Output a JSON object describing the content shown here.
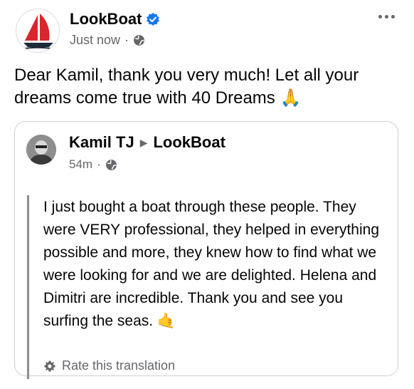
{
  "post": {
    "page_name": "LookBoat",
    "time": "Just now",
    "separator": "·",
    "text": "Dear Kamil, thank you very much! Let all your dreams come true with 40 Dreams 🙏"
  },
  "shared": {
    "author": "Kamil TJ",
    "target": "LookBoat",
    "arrow": "▶",
    "time": "54m",
    "separator": "·",
    "body": "I just bought a boat through these people. They were VERY professional, they helped in everything possible and more, they knew how to find what we were looking for and we are delighted. Helena and Dimitri are incredible. Thank you and see you surfing the seas. 🤙",
    "rate_label": "Rate this translation"
  },
  "icons": {
    "logo": "sailboat-logo",
    "verified": "verified-badge-icon",
    "privacy": "globe-icon",
    "more": "more-options-icon",
    "rate": "gear-icon"
  },
  "colors": {
    "verified_blue": "#1877f2",
    "secondary_text": "#65676b",
    "sail_red": "#d7262d"
  }
}
